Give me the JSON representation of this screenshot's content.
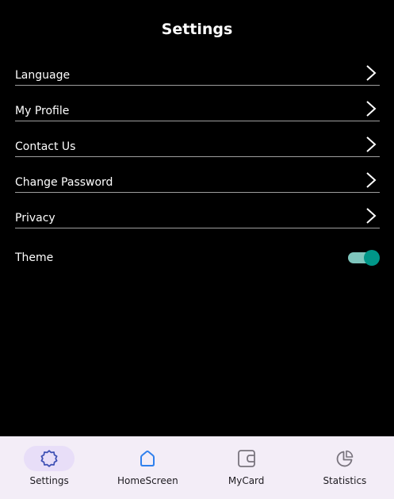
{
  "header": {
    "title": "Settings"
  },
  "settings": {
    "items": [
      {
        "label": "Language"
      },
      {
        "label": "My Profile"
      },
      {
        "label": "Contact Us"
      },
      {
        "label": "Change Password"
      },
      {
        "label": "Privacy"
      }
    ],
    "theme": {
      "label": "Theme",
      "enabled": true
    }
  },
  "bottom_nav": {
    "items": [
      {
        "label": "Settings",
        "icon": "gear-icon",
        "active": true
      },
      {
        "label": "HomeScreen",
        "icon": "home-icon",
        "active": false
      },
      {
        "label": "MyCard",
        "icon": "wallet-icon",
        "active": false
      },
      {
        "label": "Statistics",
        "icon": "pie-chart-icon",
        "active": false
      }
    ]
  },
  "colors": {
    "background": "#000000",
    "text": "#ffffff",
    "divider": "#9e9e9e",
    "toggle_thumb": "#009688",
    "toggle_track": "#7fc6bd",
    "nav_background": "#f3edf7",
    "nav_active_pill": "#e8def8",
    "gear_icon": "#3f51b5",
    "home_icon": "#2f80ed",
    "inactive_icon": "#79747e"
  }
}
